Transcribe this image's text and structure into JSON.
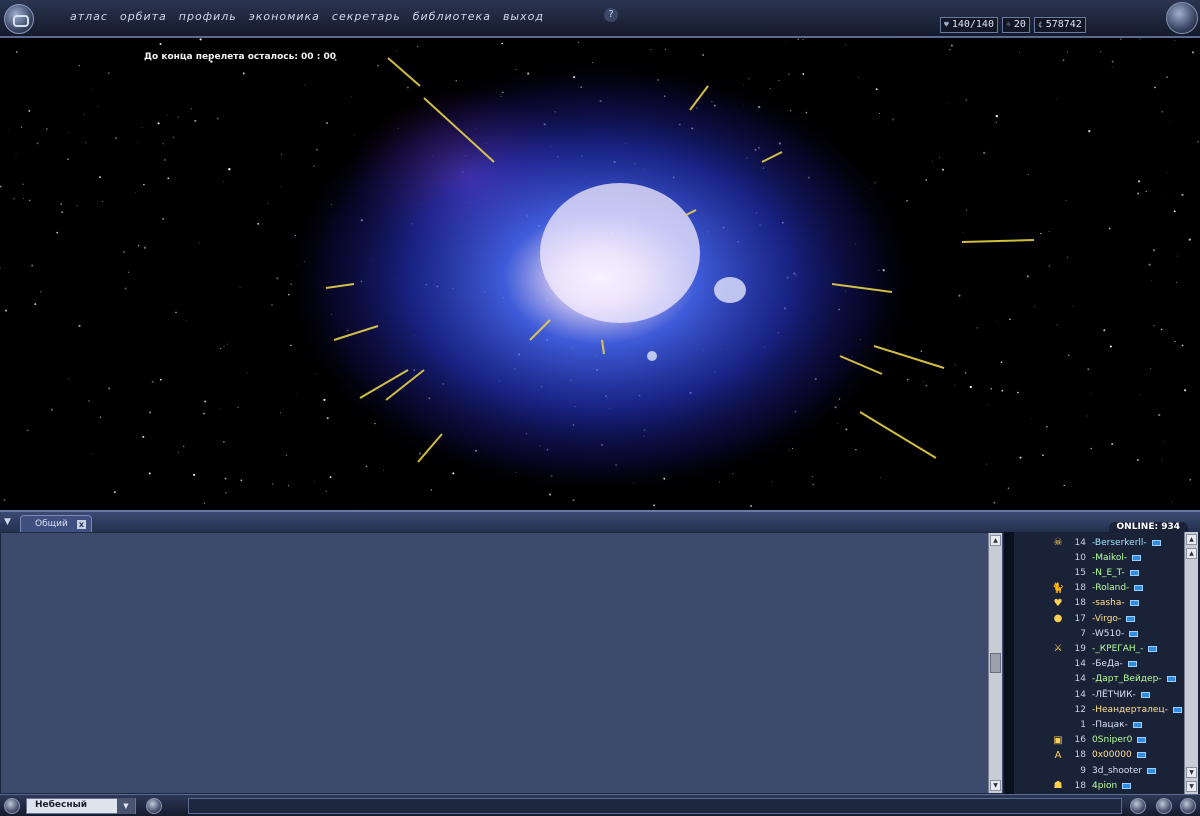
{
  "nav": {
    "items": [
      "атлас",
      "орбита",
      "профиль",
      "экономика",
      "секретарь",
      "библиотека",
      "выход"
    ],
    "help": "?"
  },
  "stats": {
    "health": "140/140",
    "level": "20",
    "money": "578742"
  },
  "space": {
    "timer": "До конца перелета осталось: 00 : 00"
  },
  "chat": {
    "toggle": "▼",
    "tab_label": "Общий",
    "tab_close": "x",
    "online_label": "ONLINE: 934"
  },
  "users": [
    {
      "level": "14",
      "name": "-Berserkerll-",
      "color": "#9ee6ff",
      "icon": "avatar-skull-icon",
      "glyph": "☠"
    },
    {
      "level": "10",
      "name": "-Maikol-",
      "color": "#b6ff9a",
      "icon": "",
      "glyph": ""
    },
    {
      "level": "15",
      "name": "-N_E_T-",
      "color": "#b6ff9a",
      "icon": "",
      "glyph": ""
    },
    {
      "level": "18",
      "name": "-Roland-",
      "color": "#b6ff9a",
      "icon": "cat-icon",
      "glyph": "🐈"
    },
    {
      "level": "18",
      "name": "-sasha-",
      "color": "#ffe08a",
      "icon": "heart-icon",
      "glyph": "♥"
    },
    {
      "level": "17",
      "name": "-Virgo-",
      "color": "#ffe08a",
      "icon": "badge-icon",
      "glyph": "●"
    },
    {
      "level": "7",
      "name": "-W510-",
      "color": "#d8e0f4",
      "icon": "",
      "glyph": ""
    },
    {
      "level": "19",
      "name": "-_КРЕГАН_-",
      "color": "#b6ff9a",
      "icon": "sword-icon",
      "glyph": "⚔"
    },
    {
      "level": "14",
      "name": "-БеДа-",
      "color": "#d8e0f4",
      "icon": "",
      "glyph": ""
    },
    {
      "level": "14",
      "name": "-Дарт_Вейдер-",
      "color": "#b6ff9a",
      "icon": "",
      "glyph": ""
    },
    {
      "level": "14",
      "name": "-ЛЁТЧИК-",
      "color": "#d8e0f4",
      "icon": "",
      "glyph": ""
    },
    {
      "level": "12",
      "name": "-Неандерталец-",
      "color": "#ffe08a",
      "icon": "",
      "glyph": ""
    },
    {
      "level": "1",
      "name": "-Пацак-",
      "color": "#d8e0f4",
      "icon": "",
      "glyph": ""
    },
    {
      "level": "16",
      "name": "0Sniper0",
      "color": "#b6ff9a",
      "icon": "frame-icon",
      "glyph": "▣"
    },
    {
      "level": "18",
      "name": "0x00000",
      "color": "#ffe08a",
      "icon": "letter-a-icon",
      "glyph": "A"
    },
    {
      "level": "9",
      "name": "3d_shooter",
      "color": "#d8e0f4",
      "icon": "",
      "glyph": ""
    },
    {
      "level": "18",
      "name": "4pion",
      "color": "#b6ff9a",
      "icon": "mask-icon",
      "glyph": "☗"
    }
  ],
  "bottom": {
    "channel": "Небесный",
    "dropdown": "▼"
  },
  "colors": {
    "accent": "#5a6a90",
    "chat_bg": "#3c4a6c",
    "userlist_bg": "#1a2238"
  }
}
